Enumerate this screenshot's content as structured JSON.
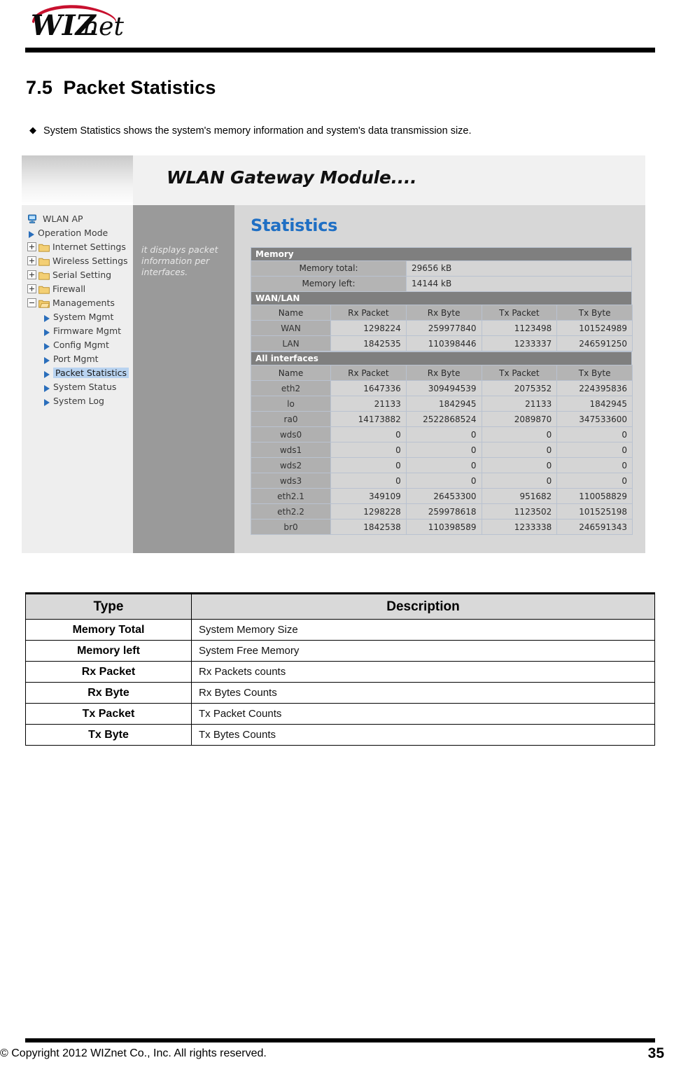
{
  "document": {
    "section_number": "7.5",
    "section_title": "Packet Statistics",
    "bullet": "System Statistics shows the system's memory information and system's data transmission size.",
    "logo_text": "WIZnet",
    "logo_accent_color": "#c8102e"
  },
  "screenshot": {
    "banner_title": "WLAN Gateway Module....",
    "note": "it displays packet information per interfaces.",
    "content_heading": "Statistics",
    "heading_color": "#1f6fc4",
    "nav": {
      "root": "WLAN AP",
      "items": [
        {
          "label": "Operation Mode",
          "icon": "arrow-icon",
          "level": 1,
          "selected": false
        },
        {
          "label": "Internet Settings",
          "icon": "folder-icon",
          "expander": "plus",
          "level": 1,
          "selected": false
        },
        {
          "label": "Wireless Settings",
          "icon": "folder-icon",
          "expander": "plus",
          "level": 1,
          "selected": false
        },
        {
          "label": "Serial Setting",
          "icon": "folder-icon",
          "expander": "plus",
          "level": 1,
          "selected": false
        },
        {
          "label": "Firewall",
          "icon": "folder-icon",
          "expander": "plus",
          "level": 1,
          "selected": false
        },
        {
          "label": "Managements",
          "icon": "folder-open-icon",
          "expander": "minus",
          "level": 1,
          "selected": false
        },
        {
          "label": "System Mgmt",
          "icon": "arrow-icon",
          "level": 2,
          "selected": false
        },
        {
          "label": "Firmware Mgmt",
          "icon": "arrow-icon",
          "level": 2,
          "selected": false
        },
        {
          "label": "Config Mgmt",
          "icon": "arrow-icon",
          "level": 2,
          "selected": false
        },
        {
          "label": "Port Mgmt",
          "icon": "arrow-icon",
          "level": 2,
          "selected": false
        },
        {
          "label": "Packet Statistics",
          "icon": "arrow-icon",
          "level": 2,
          "selected": true
        },
        {
          "label": "System Status",
          "icon": "arrow-icon",
          "level": 2,
          "selected": false
        },
        {
          "label": "System Log",
          "icon": "arrow-icon",
          "level": 2,
          "selected": false
        }
      ]
    },
    "memory": {
      "band": "Memory",
      "rows": [
        {
          "label": "Memory total:",
          "value": "29656 kB"
        },
        {
          "label": "Memory left:",
          "value": "14144 kB"
        }
      ]
    },
    "wan_lan": {
      "band": "WAN/LAN",
      "columns": [
        "Name",
        "Rx Packet",
        "Rx Byte",
        "Tx Packet",
        "Tx Byte"
      ],
      "rows": [
        [
          "WAN",
          "1298224",
          "259977840",
          "1123498",
          "101524989"
        ],
        [
          "LAN",
          "1842535",
          "110398446",
          "1233337",
          "246591250"
        ]
      ]
    },
    "all_interfaces": {
      "band": "All interfaces",
      "columns": [
        "Name",
        "Rx Packet",
        "Rx Byte",
        "Tx Packet",
        "Tx Byte"
      ],
      "rows": [
        [
          "eth2",
          "1647336",
          "309494539",
          "2075352",
          "224395836"
        ],
        [
          "lo",
          "21133",
          "1842945",
          "21133",
          "1842945"
        ],
        [
          "ra0",
          "14173882",
          "2522868524",
          "2089870",
          "347533600"
        ],
        [
          "wds0",
          "0",
          "0",
          "0",
          "0"
        ],
        [
          "wds1",
          "0",
          "0",
          "0",
          "0"
        ],
        [
          "wds2",
          "0",
          "0",
          "0",
          "0"
        ],
        [
          "wds3",
          "0",
          "0",
          "0",
          "0"
        ],
        [
          "eth2.1",
          "349109",
          "26453300",
          "951682",
          "110058829"
        ],
        [
          "eth2.2",
          "1298228",
          "259978618",
          "1123502",
          "101525198"
        ],
        [
          "br0",
          "1842538",
          "110398589",
          "1233338",
          "246591343"
        ]
      ]
    }
  },
  "description_table": {
    "headers": [
      "Type",
      "Description"
    ],
    "rows": [
      {
        "type": "Memory Total",
        "description": "System Memory Size"
      },
      {
        "type": "Memory left",
        "description": "System Free Memory"
      },
      {
        "type": "Rx Packet",
        "description": "Rx Packets counts"
      },
      {
        "type": "Rx Byte",
        "description": "Rx Bytes   Counts"
      },
      {
        "type": "Tx Packet",
        "description": "Tx Packet Counts"
      },
      {
        "type": "Tx Byte",
        "description": "Tx Bytes Counts"
      }
    ]
  },
  "footer": {
    "copyright": "© Copyright 2012 WIZnet Co., Inc. All rights reserved.",
    "page_number": "35"
  }
}
